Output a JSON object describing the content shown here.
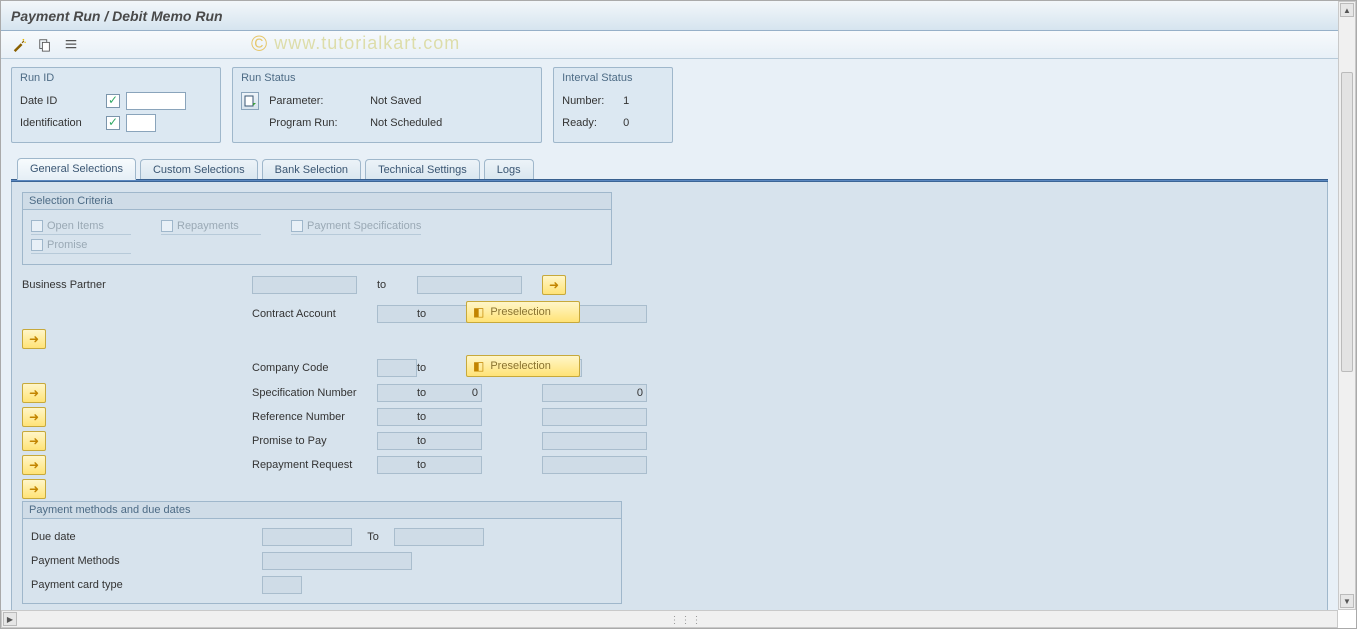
{
  "title": "Payment Run / Debit Memo Run",
  "watermark": "© www.tutorialkart.com",
  "run_id_box": {
    "title": "Run ID",
    "date_label": "Date ID",
    "date_value": "",
    "ident_label": "Identification",
    "ident_value": ""
  },
  "run_status_box": {
    "title": "Run Status",
    "param_label": "Parameter:",
    "param_value": "Not Saved",
    "prog_label": "Program Run:",
    "prog_value": "Not Scheduled"
  },
  "interval_box": {
    "title": "Interval Status",
    "number_label": "Number:",
    "number_value": "1",
    "ready_label": "Ready:",
    "ready_value": "0"
  },
  "tabs": {
    "t1": "General Selections",
    "t2": "Custom Selections",
    "t3": "Bank Selection",
    "t4": "Technical Settings",
    "t5": "Logs"
  },
  "selection_criteria": {
    "title": "Selection Criteria",
    "open_items": "Open Items",
    "repayments": "Repayments",
    "pay_spec": "Payment Specifications",
    "promise": "Promise"
  },
  "range_fields": {
    "business_partner": {
      "label": "Business Partner",
      "from": "",
      "to_label": "to",
      "to": "",
      "preselection": "Preselection"
    },
    "contract_account": {
      "label": "Contract Account",
      "from": "",
      "to_label": "to",
      "to": "",
      "preselection": "Preselection"
    },
    "company_code": {
      "label": "Company Code",
      "from": "",
      "to_label": "to",
      "to": ""
    },
    "spec_number": {
      "label": "Specification Number",
      "from": "0",
      "to_label": "to",
      "to": "0"
    },
    "ref_number": {
      "label": "Reference Number",
      "from": "",
      "to_label": "to",
      "to": ""
    },
    "promise_pay": {
      "label": "Promise to Pay",
      "from": "",
      "to_label": "to",
      "to": ""
    },
    "repay_req": {
      "label": "Repayment Request",
      "from": "",
      "to_label": "to",
      "to": ""
    }
  },
  "pm_group": {
    "title": "Payment methods and due dates",
    "due_date": {
      "label": "Due date",
      "from": "",
      "to_label": "To",
      "to": ""
    },
    "pay_methods": {
      "label": "Payment Methods",
      "value": ""
    },
    "card_type": {
      "label": "Payment card type",
      "value": ""
    }
  }
}
